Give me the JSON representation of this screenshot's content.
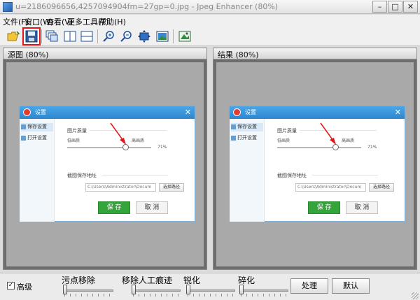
{
  "window": {
    "title": "u=2186096656,4257094904fm=27gp=0.jpg - Jpeg Enhancer (80%)",
    "min_glyph": "–",
    "max_glyph": "□",
    "close_glyph": "✕"
  },
  "menu": {
    "items": [
      "文件(F)",
      "窗口(W)",
      "查看(V)",
      "更多工具(T)",
      "帮助(H)"
    ]
  },
  "toolbar": {
    "buttons": [
      "open-icon",
      "save-icon",
      "cascade-windows-icon",
      "split-vertical-icon",
      "split-horizontal-icon",
      "zoom-in-icon",
      "zoom-out-icon",
      "fit-window-icon",
      "actual-size-icon",
      "preview-icon"
    ],
    "highlight_color": "#e0161b"
  },
  "panes": {
    "source_label": "源图 (80%)",
    "result_label": "结果 (80%)"
  },
  "dialog": {
    "title": "设置",
    "close_glyph": "✕",
    "sidebar": [
      "保存设置",
      "打开设置"
    ],
    "section_quality": "图片质量",
    "label_low": "低画质",
    "label_high": "高画质",
    "quality_value": "71%",
    "section_path": "截图保存地址",
    "path_value": "C:\\Users\\Administrator\\Docum",
    "browse_label": "选择路径",
    "save_label": "保 存",
    "cancel_label": "取 消",
    "quality_level": 0.71,
    "accent": "#33a53a"
  },
  "bottom": {
    "hq_label": "高级",
    "hq_checked": true,
    "check_glyph": "✓",
    "sliders": [
      {
        "label": "污点移除",
        "level": 0
      },
      {
        "label": "移除人工痕迹",
        "level": 0
      },
      {
        "label": "锐化",
        "level": 0
      },
      {
        "label": "碎化",
        "level": 0
      }
    ],
    "process_label": "处理",
    "default_label": "默认"
  }
}
